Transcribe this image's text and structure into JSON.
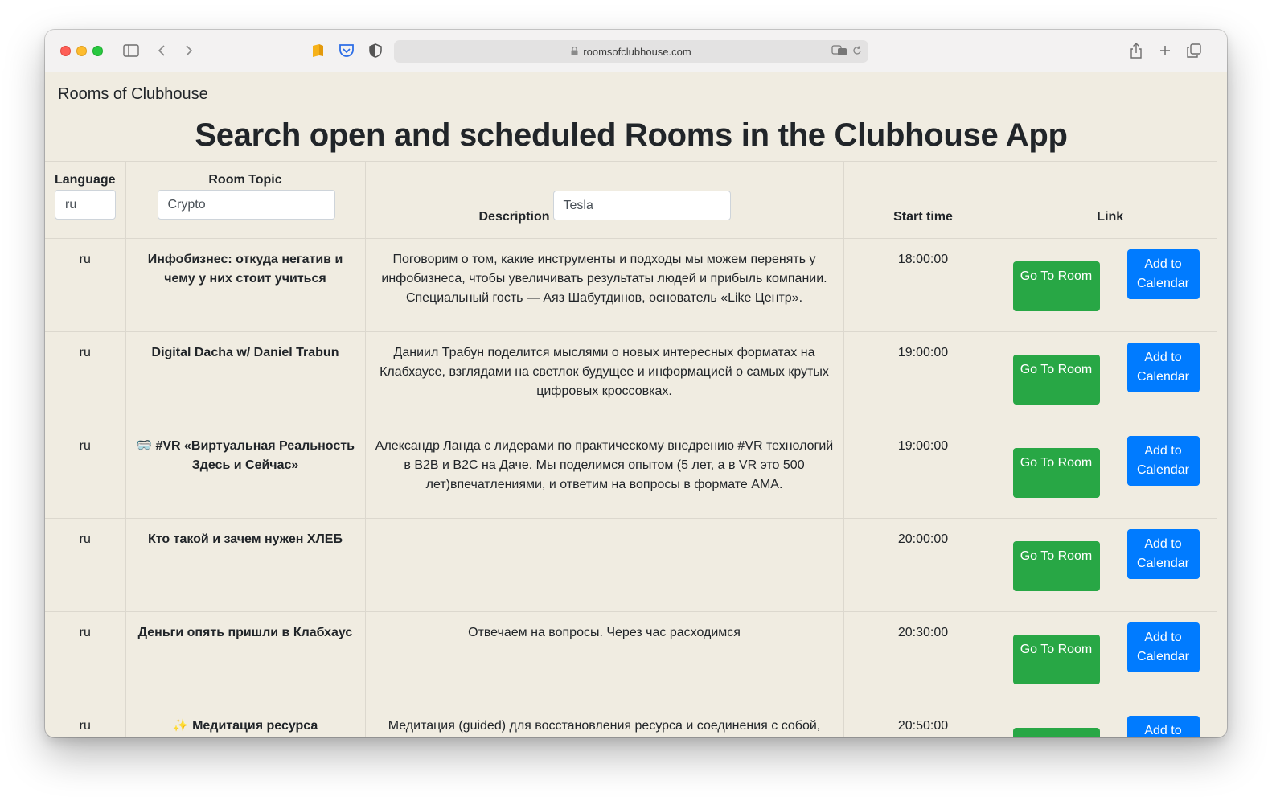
{
  "browser": {
    "url": "roomsofclubhouse.com"
  },
  "page": {
    "brand": "Rooms of Clubhouse",
    "headline": "Search open and scheduled Rooms in the Clubhouse App"
  },
  "table": {
    "headers": {
      "language": "Language",
      "topic": "Room Topic",
      "description": "Description",
      "start_time": "Start time",
      "link": "Link"
    },
    "filters": {
      "language_value": "ru",
      "topic_value": "Crypto",
      "description_value": "Tesla"
    },
    "go_label": "Go To Room",
    "calendar_label": "Add to Calendar",
    "rows": [
      {
        "lang": "ru",
        "topic": "Инфобизнес: откуда негатив и чему у них стоит учиться",
        "description": "Поговорим о том, какие инструменты и подходы мы можем перенять у инфобизнеса, чтобы увеличивать результаты людей и прибыль компании. Специальный гость — Аяз Шабутдинов, основатель «Like Центр».",
        "time": "18:00:00"
      },
      {
        "lang": "ru",
        "topic": "Digital Dacha w/ Daniel Trabun",
        "description": "Даниил Трабун поделится мыслями о новых интересных форматах на Клабхаусе, взглядами на светлок будущее и информацией о самых крутых цифровых кроссовках.",
        "time": "19:00:00"
      },
      {
        "lang": "ru",
        "topic": "🥽 #VR «Виртуальная Реальность Здесь и Сейчас»",
        "description": "Александр Ланда с лидерами по практическому внедрению #VR технологий в B2B и B2C на Даче. Мы поделимся опытом (5 лет, а в VR это 500 лет)впечатлениями, и ответим на вопросы в формате АМА.",
        "time": "19:00:00"
      },
      {
        "lang": "ru",
        "topic": "Кто такой и зачем нужен ХЛЕБ",
        "description": "",
        "time": "20:00:00"
      },
      {
        "lang": "ru",
        "topic": "Деньги опять пришли в Клабхаус",
        "description": "Отвечаем на вопросы. Через час расходимся",
        "time": "20:30:00"
      },
      {
        "lang": "ru",
        "topic": "✨ Медитация ресурса",
        "description": "Медитация (guided) для восстановления ресурса и соединения с собой,",
        "time": "20:50:00"
      }
    ]
  },
  "colors": {
    "page_bg": "#f0ece1",
    "go_button": "#28a745",
    "calendar_button": "#007bff"
  },
  "icons": [
    "sidebar-icon",
    "back-icon",
    "forward-icon",
    "bookmark-icon",
    "pocket-icon",
    "shield-icon",
    "lock-icon",
    "translate-icon",
    "reload-icon",
    "share-icon",
    "plus-icon",
    "tabs-icon"
  ]
}
